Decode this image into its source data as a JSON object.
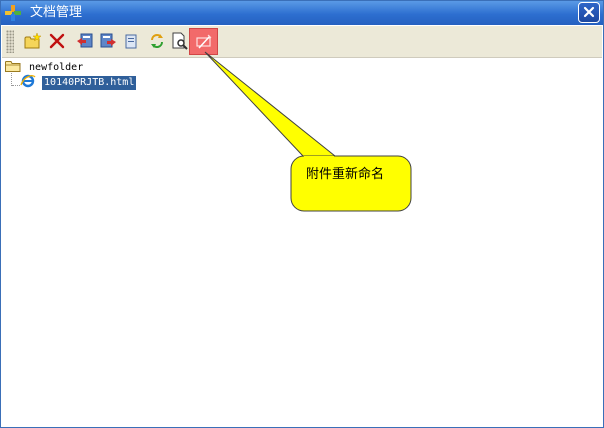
{
  "window": {
    "title": "文档管理",
    "accent_color": "#2d6fd0"
  },
  "toolbar": {
    "buttons": [
      {
        "name": "new-folder-button",
        "icon": "new-folder-icon"
      },
      {
        "name": "delete-button",
        "icon": "delete-icon"
      },
      {
        "name": "import-button",
        "icon": "import-icon"
      },
      {
        "name": "export-button",
        "icon": "export-icon"
      },
      {
        "name": "copy-button",
        "icon": "copy-icon"
      },
      {
        "name": "refresh-button",
        "icon": "refresh-icon"
      },
      {
        "name": "preview-button",
        "icon": "preview-icon"
      },
      {
        "name": "rename-attachment-button",
        "icon": "rename-icon",
        "highlighted": true
      }
    ]
  },
  "tree": {
    "folder": {
      "label": "newfolder",
      "icon": "folder-icon"
    },
    "file": {
      "label": "10140PRJTB.html",
      "icon": "ie-html-icon",
      "selected": true
    }
  },
  "callout": {
    "text": "附件重新命名",
    "fill_color": "#ffff00"
  }
}
